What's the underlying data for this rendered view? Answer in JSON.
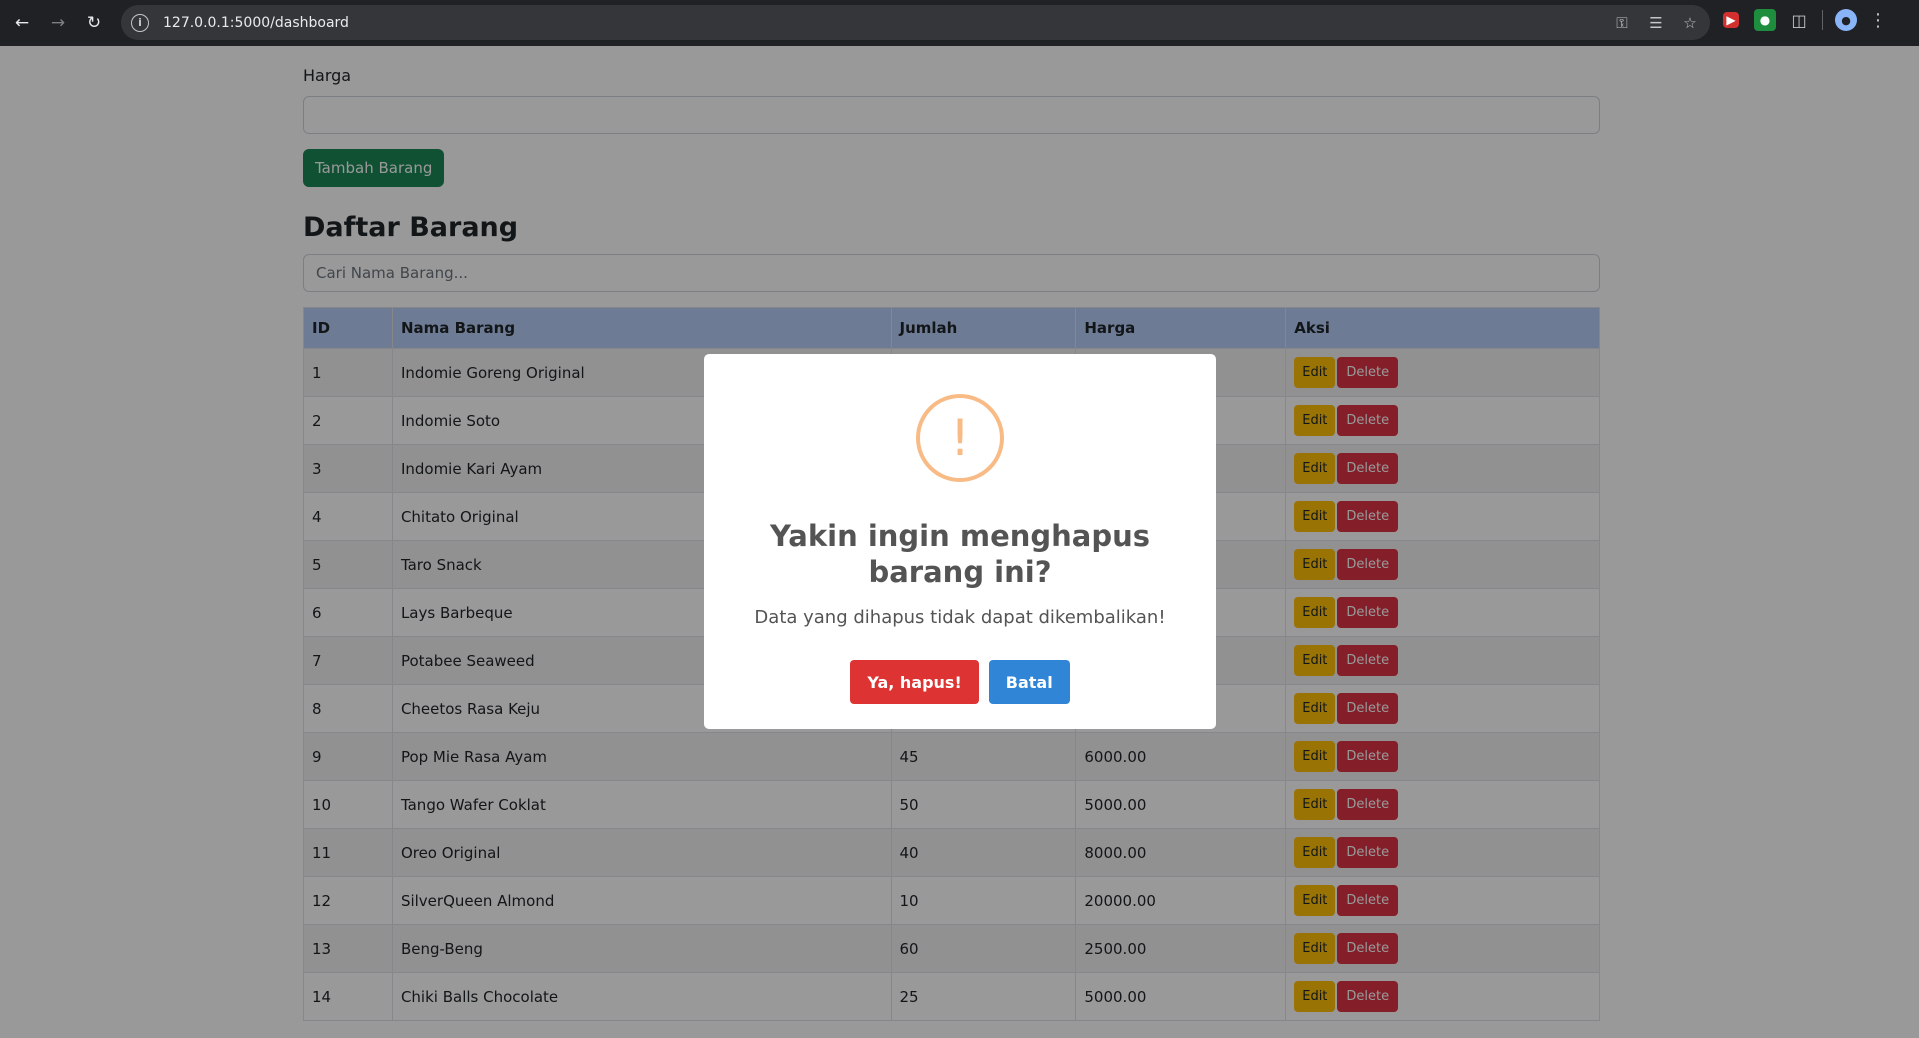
{
  "browser": {
    "url": "127.0.0.1:5000/dashboard",
    "icons": [
      "back-icon",
      "forward-icon",
      "reload-icon",
      "info-icon",
      "key-icon",
      "translate-icon",
      "star-icon",
      "extension-icon",
      "puzzle-icon",
      "avatar",
      "menu-icon"
    ]
  },
  "form": {
    "harga_label": "Harga",
    "add_button": "Tambah Barang"
  },
  "list": {
    "heading": "Daftar Barang",
    "search_placeholder": "Cari Nama Barang...",
    "columns": [
      "ID",
      "Nama Barang",
      "Jumlah",
      "Harga",
      "Aksi"
    ],
    "edit_label": "Edit",
    "delete_label": "Delete",
    "rows": [
      {
        "id": "1",
        "name": "Indomie Goreng Original",
        "qty": "",
        "price": ""
      },
      {
        "id": "2",
        "name": "Indomie Soto",
        "qty": "",
        "price": ""
      },
      {
        "id": "3",
        "name": "Indomie Kari Ayam",
        "qty": "",
        "price": ""
      },
      {
        "id": "4",
        "name": "Chitato Original",
        "qty": "",
        "price": ""
      },
      {
        "id": "5",
        "name": "Taro Snack",
        "qty": "",
        "price": ""
      },
      {
        "id": "6",
        "name": "Lays Barbeque",
        "qty": "",
        "price": ""
      },
      {
        "id": "7",
        "name": "Potabee Seaweed",
        "qty": "",
        "price": ""
      },
      {
        "id": "8",
        "name": "Cheetos Rasa Keju",
        "qty": "",
        "price": ""
      },
      {
        "id": "9",
        "name": "Pop Mie Rasa Ayam",
        "qty": "45",
        "price": "6000.00"
      },
      {
        "id": "10",
        "name": "Tango Wafer Coklat",
        "qty": "50",
        "price": "5000.00"
      },
      {
        "id": "11",
        "name": "Oreo Original",
        "qty": "40",
        "price": "8000.00"
      },
      {
        "id": "12",
        "name": "SilverQueen Almond",
        "qty": "10",
        "price": "20000.00"
      },
      {
        "id": "13",
        "name": "Beng-Beng",
        "qty": "60",
        "price": "2500.00"
      },
      {
        "id": "14",
        "name": "Chiki Balls Chocolate",
        "qty": "25",
        "price": "5000.00"
      }
    ]
  },
  "modal": {
    "icon_glyph": "!",
    "title": "Yakin ingin menghapus barang ini?",
    "text": "Data yang dihapus tidak dapat dikembalikan!",
    "confirm_label": "Ya, hapus!",
    "cancel_label": "Batal"
  },
  "colors": {
    "success": "#198754",
    "warning": "#ffc107",
    "danger": "#dc3545",
    "confirm": "#dd3333",
    "cancel": "#3085d6",
    "table_header": "#b6cdf7",
    "warn_icon": "#f8bb86"
  }
}
